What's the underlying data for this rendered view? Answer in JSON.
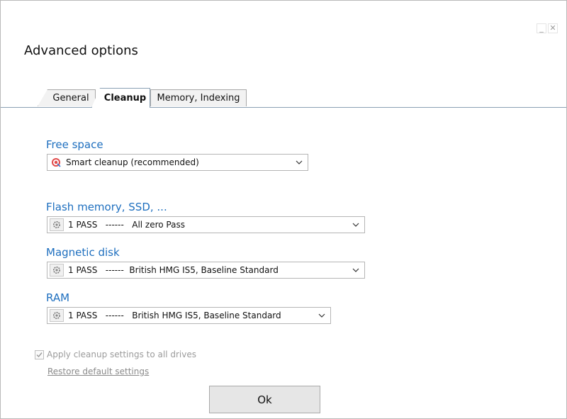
{
  "window": {
    "minimize_label": "_",
    "close_label": "✕"
  },
  "dialog": {
    "title": "Advanced options"
  },
  "tabs": [
    {
      "label": "General"
    },
    {
      "label": "Cleanup",
      "active": true
    },
    {
      "label": "Memory, Indexing"
    }
  ],
  "free_space": {
    "label": "Free space",
    "value": "Smart cleanup (recommended)",
    "icon": "target-icon"
  },
  "flash": {
    "label": "Flash memory, SSD, ...",
    "value": "1 PASS   ------   All zero Pass",
    "icon": "gear-icon"
  },
  "magnetic": {
    "label": "Magnetic disk",
    "value": "1 PASS   ------  British HMG IS5, Baseline Standard",
    "icon": "gear-icon"
  },
  "ram": {
    "label": "RAM",
    "value": "1 PASS   ------   British HMG IS5, Baseline Standard",
    "icon": "gear-icon"
  },
  "apply_all": {
    "label": "Apply cleanup settings to all drives",
    "checked": true
  },
  "restore_link": "Restore default settings",
  "ok_label": "Ok",
  "colors": {
    "section_label": "#1e6fbf",
    "disabled_text": "#9b9b9b"
  }
}
